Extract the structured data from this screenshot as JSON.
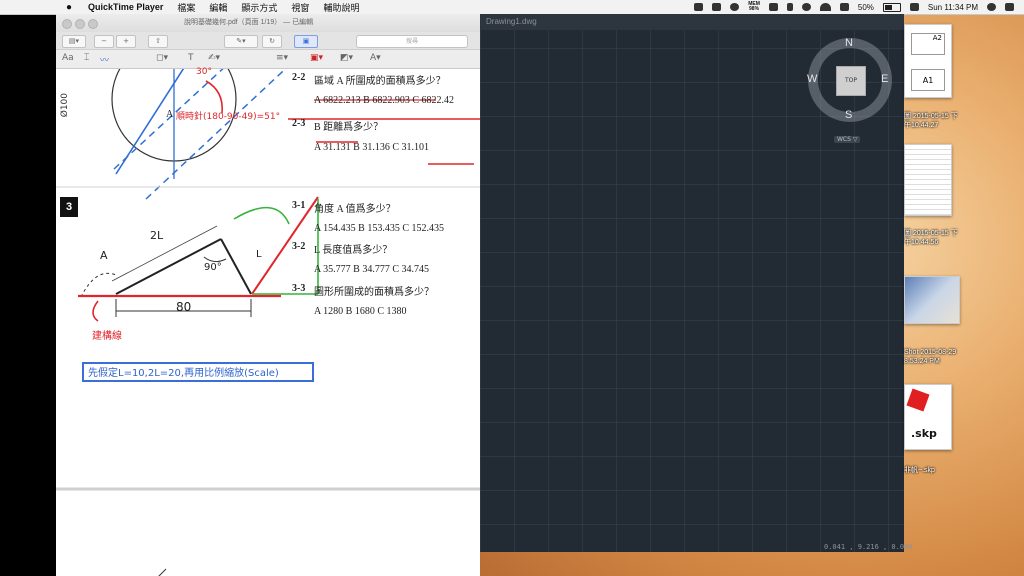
{
  "menubar": {
    "app_name": "QuickTime Player",
    "menus": [
      "檔案",
      "編輯",
      "顯示方式",
      "視窗",
      "輔助說明"
    ],
    "mem_label": "MEM",
    "mem_value": "98%",
    "battery": "50%",
    "clock": "Sun 11:34 PM"
  },
  "pdf_window": {
    "title": "說明基礎幾何.pdf（頁面 1/19）",
    "title_suffix": "— 已編輯",
    "search_placeholder": "搜尋",
    "toolbar_text": "Aa",
    "question_badge": "3",
    "q2": {
      "q22_label": "2-2",
      "q22_text": "區域 A 所圍成的面積爲多少？",
      "q22_choices": "A 6822.213  B 6822.903  C 6822.42",
      "q23_label": "2-3",
      "q23_text": "B 距離爲多少？",
      "q23_choices": "A 31.131    B 31.136    C 31.101",
      "handnote": "順時針(180-90-49)=51°",
      "angle_note": "30°",
      "dim": "Ø100",
      "label_A": "A"
    },
    "q3": {
      "q31_label": "3-1",
      "q31_text": "角度 A 值爲多少？",
      "q31_choices": "A 154.435   B 153.435   C 152.435",
      "q32_label": "3-2",
      "q32_text": "L 長度值爲多少？",
      "q32_choices": "A 35.777    B 34.777    C 34.745",
      "q33_label": "3-3",
      "q33_text": "圖形所圍成的面積爲多少？",
      "q33_choices": "A 1280      B 1680      C 1380",
      "fig_A": "A",
      "fig_2L": "2L",
      "fig_90": "90°",
      "fig_L": "L",
      "fig_80": "80",
      "construction_note": "建構線"
    },
    "blue_note": "先假定L=10,2L=20,再用比例縮放(Scale)"
  },
  "cad_window": {
    "title": "Drawing1.dwg",
    "viewcube": {
      "top": "TOP",
      "n": "N",
      "s": "S",
      "e": "E",
      "w": "W"
    },
    "wcs_label": "WCS ▽",
    "coords": "0.041 , 9.216 , 0.000"
  },
  "desktop_files": [
    {
      "label_line1": "圖 2015-05-15 下",
      "label_line2": "午10.44.27"
    },
    {
      "label_line1": "圖 2015-05-15 下",
      "label_line2": "午10.44.56"
    },
    {
      "label_line1": "Shot 2015-08-29",
      "label_line2": "8.53.24 PM"
    },
    {
      "label_line1": ".skp",
      "label_line2": "非帆~.skp"
    }
  ],
  "thumb1_text": {
    "a2": "A2",
    "a1": "A1"
  }
}
